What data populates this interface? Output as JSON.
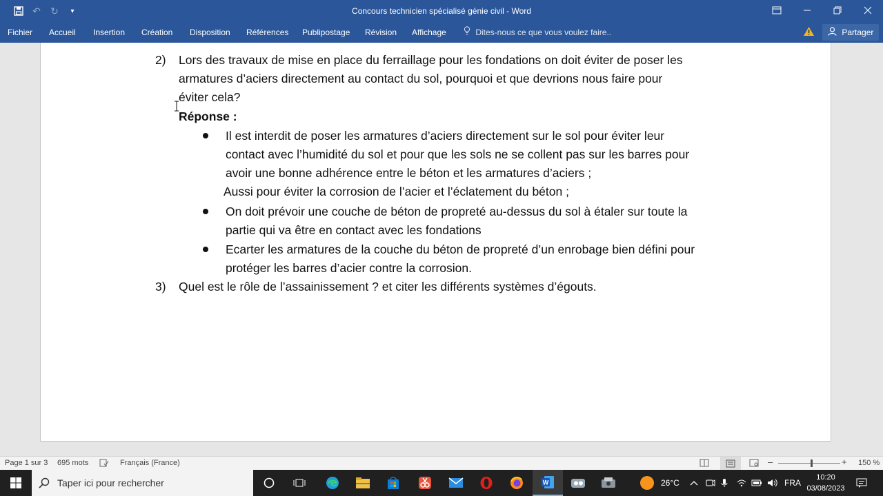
{
  "window": {
    "title": "Concours technicien spécialisé génie civil - Word"
  },
  "ribbon": {
    "tabs": [
      "Fichier",
      "Accueil",
      "Insertion",
      "Création",
      "Disposition",
      "Références",
      "Publipostage",
      "Révision",
      "Affichage"
    ],
    "tell_me": "Dites-nous ce que vous voulez faire..",
    "share": "Partager"
  },
  "document": {
    "q2_number": "2)",
    "q2_lines": [
      "Lors des travaux de mise en place du ferraillage pour les fondations on doit éviter de poser les",
      "armatures d’aciers directement au contact du sol, pourquoi et que devrions nous faire pour",
      "éviter cela?"
    ],
    "answer_label": "Réponse :",
    "bullet1_lines": [
      "Il est interdit de poser les armatures d’aciers directement sur le sol pour éviter leur",
      "contact avec l’humidité du sol et pour que les sols ne se collent pas sur les barres pour",
      "avoir une bonne adhérence entre le béton et les armatures d’aciers ;"
    ],
    "bullet1_extra": "Aussi pour éviter la corrosion de l’acier et l’éclatement du béton ;",
    "bullet2_lines": [
      "On doit prévoir une couche de béton de propreté au-dessus du sol à étaler sur toute la",
      "partie qui va être en contact avec les fondations"
    ],
    "bullet3_lines": [
      "Ecarter les armatures de la couche du béton de propreté d’un enrobage bien défini pour",
      "protéger les barres d’acier contre la corrosion."
    ],
    "q3_number": "3)",
    "q3_line": "Quel est le rôle de l’assainissement ? et citer les différents systèmes d’égouts."
  },
  "status": {
    "page": "Page 1 sur 3",
    "words": "695 mots",
    "language": "Français (France)",
    "zoom": "150 %",
    "zoom_level_percent": 150
  },
  "taskbar": {
    "search_placeholder": "Taper ici pour rechercher",
    "temperature": "26°C",
    "language": "FRA",
    "time": "10:20",
    "date": "03/08/2023"
  },
  "colors": {
    "word_blue": "#2b579a",
    "taskbar": "#202020"
  }
}
